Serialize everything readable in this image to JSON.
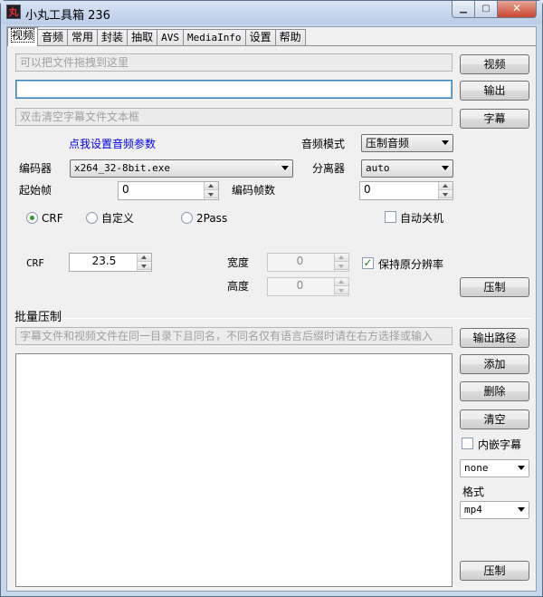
{
  "window": {
    "title": "小丸工具箱 236",
    "app_icon": "丸"
  },
  "tabs": [
    {
      "label": "视频",
      "active": true
    },
    {
      "label": "音频"
    },
    {
      "label": "常用"
    },
    {
      "label": "封装"
    },
    {
      "label": "抽取"
    },
    {
      "label": "AVS"
    },
    {
      "label": "MediaInfo"
    },
    {
      "label": "设置"
    },
    {
      "label": "帮助"
    }
  ],
  "video": {
    "drop_hint": "可以把文件拖拽到这里",
    "output_path": "",
    "subtitle_hint": "双击清空字幕文件文本框",
    "video_btn": "视频",
    "output_btn": "输出",
    "subtitle_btn": "字幕",
    "audio_params_link": "点我设置音频参数",
    "audio_mode_label": "音频模式",
    "audio_mode_value": "压制音频",
    "encoder_label": "编码器",
    "encoder_value": "x264_32-8bit.exe",
    "demuxer_label": "分离器",
    "demuxer_value": "auto",
    "start_frame_label": "起始帧",
    "start_frame_value": "0",
    "encode_frames_label": "编码帧数",
    "encode_frames_value": "0",
    "rc_modes": [
      "CRF",
      "自定义",
      "2Pass"
    ],
    "auto_shutdown_label": "自动关机",
    "crf_label": "CRF",
    "crf_value": "23.5",
    "width_label": "宽度",
    "width_value": "0",
    "height_label": "高度",
    "height_value": "0",
    "keep_res_label": "保持原分辨率",
    "compress_btn": "压制"
  },
  "batch": {
    "group_label": "批量压制",
    "hint": "字幕文件和视频文件在同一目录下且同名，不同名仅有语言后缀时请在右方选择或输入",
    "output_path_btn": "输出路径",
    "add_btn": "添加",
    "delete_btn": "删除",
    "clear_btn": "清空",
    "embed_sub_label": "内嵌字幕",
    "sub_lang_value": "none",
    "format_label": "格式",
    "format_value": "mp4",
    "compress_btn": "压制"
  }
}
